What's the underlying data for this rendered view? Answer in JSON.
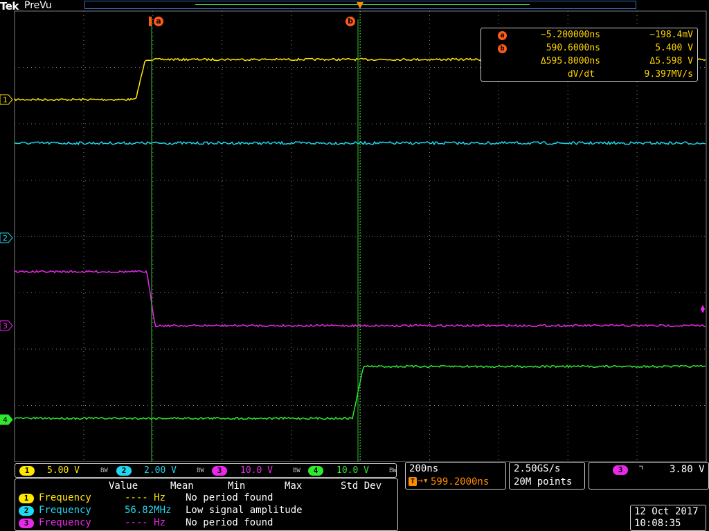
{
  "header": {
    "brand": "Tek",
    "mode": "PreVu"
  },
  "colors": {
    "ch1": "#ffe800",
    "ch2": "#1fd7ee",
    "ch3": "#e82ae8",
    "ch4": "#31e831",
    "cursor": "#ff5a1a",
    "grid": "#808080",
    "panel_border": "#cfcfcf"
  },
  "cursors": {
    "a_label": "a",
    "b_label": "b"
  },
  "readout": {
    "a": {
      "time": "−5.200000ns",
      "value": "−198.4mV"
    },
    "b": {
      "time": "590.6000ns",
      "value": "5.400 V"
    },
    "delta_time": "Δ595.8000ns",
    "delta_value": "Δ5.598 V",
    "rate_label": "dV/dt",
    "rate_value": "9.397MV/s"
  },
  "channels": [
    {
      "num": "1",
      "scale": "5.00 V",
      "bw": "BW"
    },
    {
      "num": "2",
      "scale": "2.00 V",
      "bw": "BW"
    },
    {
      "num": "3",
      "scale": "10.0 V",
      "bw": "BW"
    },
    {
      "num": "4",
      "scale": "10.0 V",
      "bw": "BW"
    }
  ],
  "timebase": {
    "per_div": "200ns",
    "trigger_pos": "599.2000ns"
  },
  "acquisition": {
    "sample_rate": "2.50GS/s",
    "record_length": "20M points"
  },
  "trigger": {
    "source": "3",
    "slope": "falling-edge-icon",
    "level": "3.80 V"
  },
  "measurements": {
    "headers": [
      "Value",
      "Mean",
      "Min",
      "Max",
      "Std Dev"
    ],
    "rows": [
      {
        "num": "1",
        "name": "Frequency",
        "value": "---- Hz",
        "message": "No period found"
      },
      {
        "num": "2",
        "name": "Frequency",
        "value": "56.82MHz",
        "message": "Low signal amplitude"
      },
      {
        "num": "3",
        "name": "Frequency",
        "value": "---- Hz",
        "message": "No period found"
      }
    ]
  },
  "datetime": {
    "date": "12 Oct 2017",
    "time": "10:08:35"
  }
}
